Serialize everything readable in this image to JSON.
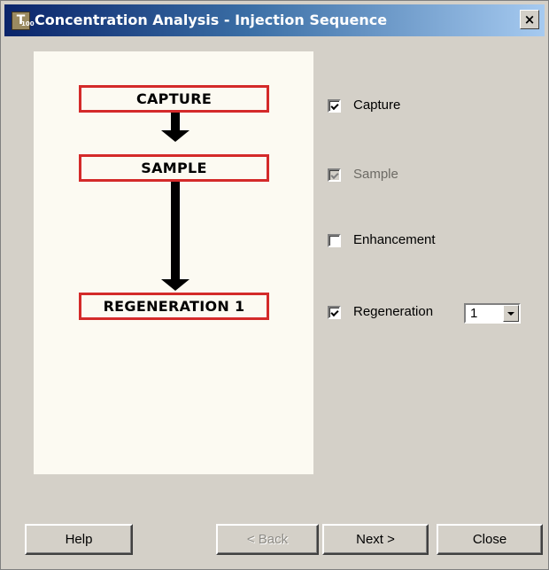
{
  "window": {
    "title": "Concentration Analysis - Injection Sequence",
    "icon": "T",
    "icon_sub": "100",
    "close_glyph": "×"
  },
  "diagram": {
    "steps": [
      "CAPTURE",
      "SAMPLE",
      "REGENERATION 1"
    ]
  },
  "options": [
    {
      "label": "Capture",
      "checked": true,
      "enabled": true
    },
    {
      "label": "Sample",
      "checked": true,
      "enabled": false
    },
    {
      "label": "Enhancement",
      "checked": false,
      "enabled": true
    },
    {
      "label": "Regeneration",
      "checked": true,
      "enabled": true
    }
  ],
  "regeneration_count": {
    "value": "1"
  },
  "buttons": {
    "help": "Help",
    "back": "< Back",
    "next": "Next >",
    "close": "Close"
  },
  "colors": {
    "step_border": "#d42a2a",
    "panel_bg": "#fcfaf2",
    "dialog_bg": "#d4d0c8",
    "titlebar_start": "#0a246a"
  }
}
